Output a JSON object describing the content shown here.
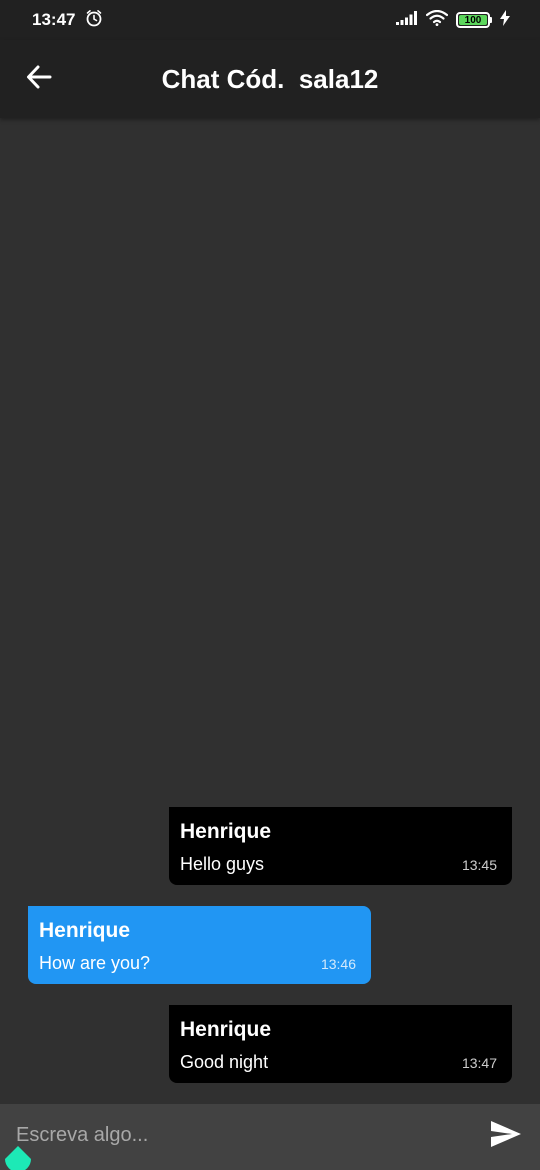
{
  "status_bar": {
    "time": "13:47",
    "battery_level": "100",
    "icons": [
      "alarm-icon",
      "signal-icon",
      "wifi-icon",
      "battery-icon",
      "charging-icon"
    ]
  },
  "app_bar": {
    "title": "Chat Cód.  sala12",
    "back_icon": "arrow-back-icon"
  },
  "messages": [
    {
      "sender": "Henrique",
      "text": "Hello guys",
      "time": "13:45",
      "style": "sent"
    },
    {
      "sender": "Henrique",
      "text": "How are you?",
      "time": "13:46",
      "style": "received"
    },
    {
      "sender": "Henrique",
      "text": "Good night",
      "time": "13:47",
      "style": "sent"
    }
  ],
  "input_bar": {
    "placeholder": "Escreva algo...",
    "value": "",
    "send_icon": "send-icon"
  },
  "colors": {
    "background": "#303030",
    "app_bar": "#212121",
    "sent_bubble": "#000000",
    "received_bubble": "#2196f3",
    "input_bar": "#424242",
    "accent_handle": "#1de9b6"
  }
}
